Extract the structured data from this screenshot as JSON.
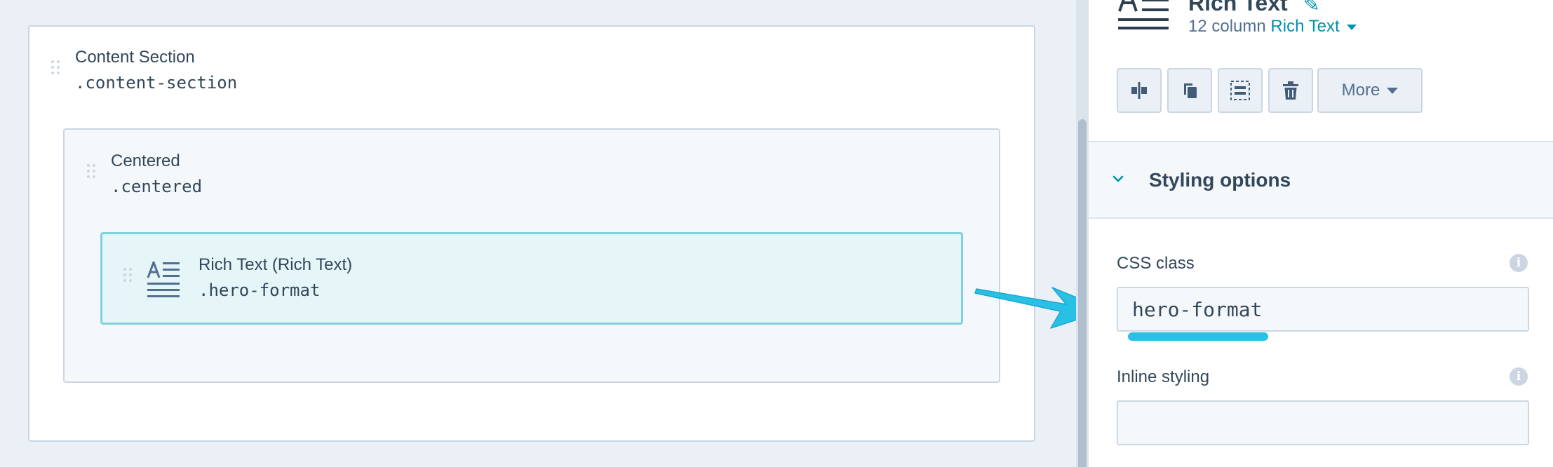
{
  "canvas": {
    "section": {
      "title": "Content Section",
      "class_name": ".content-section"
    },
    "centered": {
      "title": "Centered",
      "class_name": ".centered"
    },
    "module": {
      "title": "Rich Text (Rich Text)",
      "class_name": ".hero-format",
      "icon": "rich-text-icon"
    }
  },
  "panel": {
    "title": "Rich Text",
    "subtitle_prefix": "12 column",
    "subtitle_link": "Rich Text",
    "toolbar": {
      "buttons": [
        "split-column-icon",
        "clone-icon",
        "wrap-icon",
        "trash-icon"
      ],
      "more_label": "More"
    },
    "styling_section": {
      "title": "Styling options",
      "expanded": true
    },
    "css_class": {
      "label": "CSS class",
      "value": "hero-format"
    },
    "inline_styling": {
      "label": "Inline styling",
      "value": ""
    }
  },
  "annotation": {
    "arrow_color": "#29c0e6",
    "underline_color": "#29c0e6"
  },
  "colors": {
    "accent": "#0091ae",
    "module_fill": "#e5f5f8",
    "module_border": "#7fd1de"
  }
}
